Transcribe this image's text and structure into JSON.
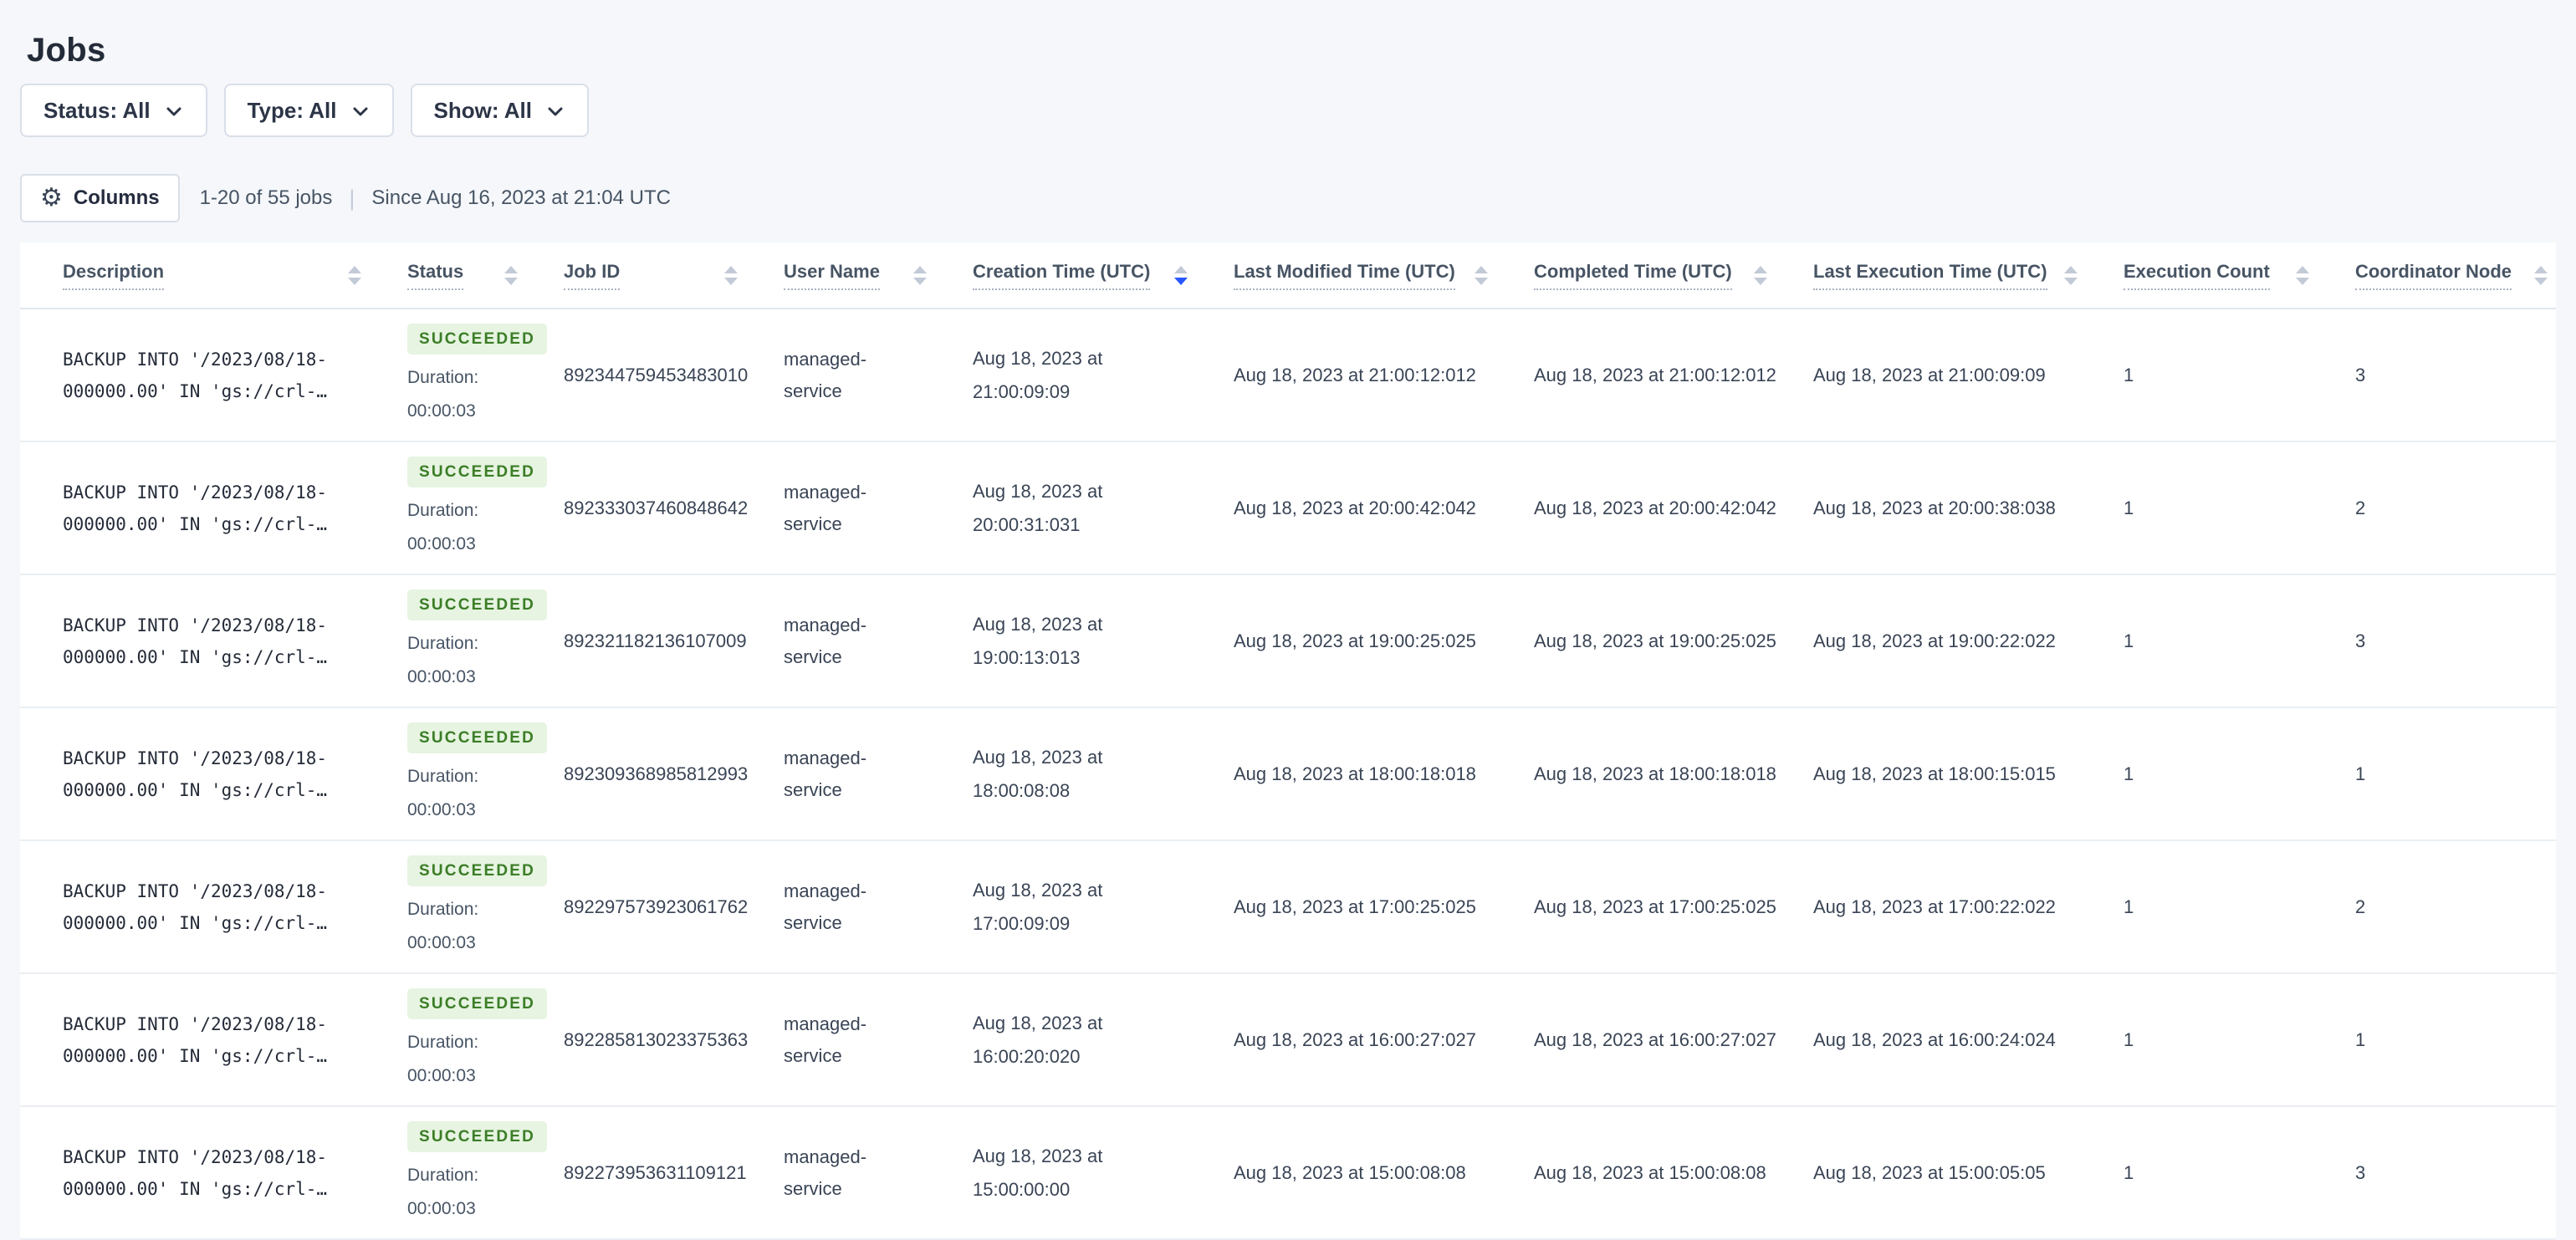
{
  "page": {
    "title": "Jobs"
  },
  "filters": [
    {
      "label": "Status: All"
    },
    {
      "label": "Type: All"
    },
    {
      "label": "Show: All"
    }
  ],
  "toolbar": {
    "gear_glyph": "⚙",
    "columns_label": "Columns",
    "results_text": "1-20 of 55 jobs",
    "separator": "|",
    "since_text": "Since Aug 16, 2023 at 21:04 UTC"
  },
  "table": {
    "duration_label": "Duration:",
    "columns": [
      {
        "label": "Description",
        "sort": "none"
      },
      {
        "label": "Status",
        "sort": "none"
      },
      {
        "label": "Job ID",
        "sort": "none"
      },
      {
        "label": "User Name",
        "sort": "none"
      },
      {
        "label": "Creation Time (UTC)",
        "sort": "desc"
      },
      {
        "label": "Last Modified Time (UTC)",
        "sort": "none"
      },
      {
        "label": "Completed Time (UTC)",
        "sort": "none"
      },
      {
        "label": "Last Execution Time (UTC)",
        "sort": "none"
      },
      {
        "label": "Execution Count",
        "sort": "none"
      },
      {
        "label": "Coordinator Node",
        "sort": "none"
      }
    ],
    "rows": [
      {
        "description": "BACKUP INTO '/2023/08/18-000000.00' IN 'gs://crl-…",
        "status": "SUCCEEDED",
        "duration": "00:00:03",
        "job_id": "892344759453483010",
        "user_name": "managed-service",
        "creation_time": "Aug 18, 2023 at 21:00:09:09",
        "last_modified_time": "Aug 18, 2023 at 21:00:12:012",
        "completed_time": "Aug 18, 2023 at 21:00:12:012",
        "last_execution_time": "Aug 18, 2023 at 21:00:09:09",
        "execution_count": "1",
        "coordinator_node": "3"
      },
      {
        "description": "BACKUP INTO '/2023/08/18-000000.00' IN 'gs://crl-…",
        "status": "SUCCEEDED",
        "duration": "00:00:03",
        "job_id": "892333037460848642",
        "user_name": "managed-service",
        "creation_time": "Aug 18, 2023 at 20:00:31:031",
        "last_modified_time": "Aug 18, 2023 at 20:00:42:042",
        "completed_time": "Aug 18, 2023 at 20:00:42:042",
        "last_execution_time": "Aug 18, 2023 at 20:00:38:038",
        "execution_count": "1",
        "coordinator_node": "2"
      },
      {
        "description": "BACKUP INTO '/2023/08/18-000000.00' IN 'gs://crl-…",
        "status": "SUCCEEDED",
        "duration": "00:00:03",
        "job_id": "892321182136107009",
        "user_name": "managed-service",
        "creation_time": "Aug 18, 2023 at 19:00:13:013",
        "last_modified_time": "Aug 18, 2023 at 19:00:25:025",
        "completed_time": "Aug 18, 2023 at 19:00:25:025",
        "last_execution_time": "Aug 18, 2023 at 19:00:22:022",
        "execution_count": "1",
        "coordinator_node": "3"
      },
      {
        "description": "BACKUP INTO '/2023/08/18-000000.00' IN 'gs://crl-…",
        "status": "SUCCEEDED",
        "duration": "00:00:03",
        "job_id": "892309368985812993",
        "user_name": "managed-service",
        "creation_time": "Aug 18, 2023 at 18:00:08:08",
        "last_modified_time": "Aug 18, 2023 at 18:00:18:018",
        "completed_time": "Aug 18, 2023 at 18:00:18:018",
        "last_execution_time": "Aug 18, 2023 at 18:00:15:015",
        "execution_count": "1",
        "coordinator_node": "1"
      },
      {
        "description": "BACKUP INTO '/2023/08/18-000000.00' IN 'gs://crl-…",
        "status": "SUCCEEDED",
        "duration": "00:00:03",
        "job_id": "892297573923061762",
        "user_name": "managed-service",
        "creation_time": "Aug 18, 2023 at 17:00:09:09",
        "last_modified_time": "Aug 18, 2023 at 17:00:25:025",
        "completed_time": "Aug 18, 2023 at 17:00:25:025",
        "last_execution_time": "Aug 18, 2023 at 17:00:22:022",
        "execution_count": "1",
        "coordinator_node": "2"
      },
      {
        "description": "BACKUP INTO '/2023/08/18-000000.00' IN 'gs://crl-…",
        "status": "SUCCEEDED",
        "duration": "00:00:03",
        "job_id": "892285813023375363",
        "user_name": "managed-service",
        "creation_time": "Aug 18, 2023 at 16:00:20:020",
        "last_modified_time": "Aug 18, 2023 at 16:00:27:027",
        "completed_time": "Aug 18, 2023 at 16:00:27:027",
        "last_execution_time": "Aug 18, 2023 at 16:00:24:024",
        "execution_count": "1",
        "coordinator_node": "1"
      },
      {
        "description": "BACKUP INTO '/2023/08/18-000000.00' IN 'gs://crl-…",
        "status": "SUCCEEDED",
        "duration": "00:00:03",
        "job_id": "892273953631109121",
        "user_name": "managed-service",
        "creation_time": "Aug 18, 2023 at 15:00:00:00",
        "last_modified_time": "Aug 18, 2023 at 15:00:08:08",
        "completed_time": "Aug 18, 2023 at 15:00:08:08",
        "last_execution_time": "Aug 18, 2023 at 15:00:05:05",
        "execution_count": "1",
        "coordinator_node": "3"
      }
    ]
  },
  "colors": {
    "background": "#f5f7fa",
    "success_text": "#3b7d26",
    "success_background": "#e6f4e1",
    "active_sort_blue": "#2957ff"
  }
}
